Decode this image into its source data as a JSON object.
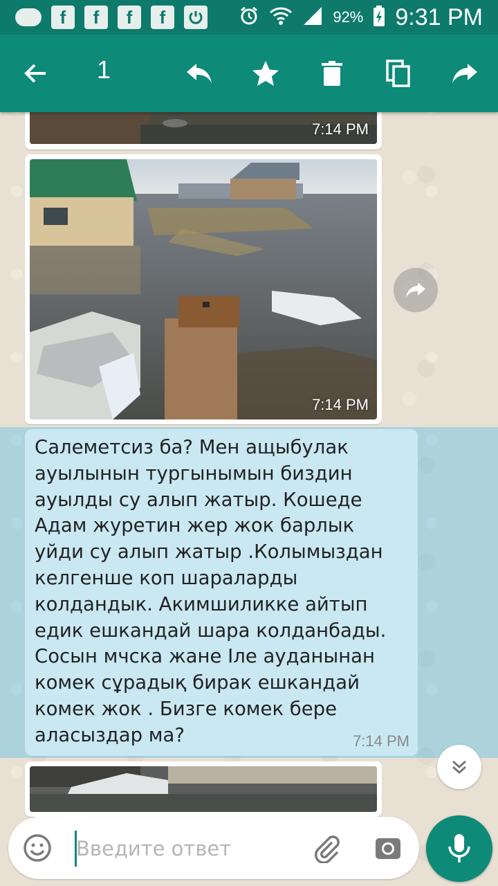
{
  "status_bar": {
    "notif_icons": [
      "message-icon",
      "facebook-icon",
      "facebook-icon",
      "facebook-icon",
      "facebook-icon",
      "power-icon"
    ],
    "facebook_glyph": "f",
    "battery": "92%",
    "time": "9:31 PM"
  },
  "toolbar": {
    "selected_count": "1",
    "actions": [
      "back",
      "reply",
      "star",
      "delete",
      "copy",
      "forward"
    ]
  },
  "messages": [
    {
      "type": "image",
      "time": "7:14 PM"
    },
    {
      "type": "image",
      "time": "7:14 PM"
    },
    {
      "type": "text",
      "selected": true,
      "text": "Салеметсиз ба? Мен ащыбулак\nауылынын тургынымын биздин\nауылды су алып жатыр. Кошеде\nАдам журетин жер жок барлык\nуйди су алып жатыр .Колымыздан\nкелгенше коп шараларды\nколдандык. Акимшиликке айтып\nедик ешкандай шара колданбады.\nСосын мчска жане Іле ауданынан\nкомек сұрадық бирак ешкандай\nкомек жок . Бизге комек бере\naласыздар ма?",
      "time": "7:14 PM"
    },
    {
      "type": "image"
    }
  ],
  "input": {
    "placeholder": "Введите ответ",
    "value": ""
  },
  "colors": {
    "header": "#0d8a78",
    "status_bar": "#0d7a6b",
    "selected_bubble": "#c9e8f2"
  }
}
